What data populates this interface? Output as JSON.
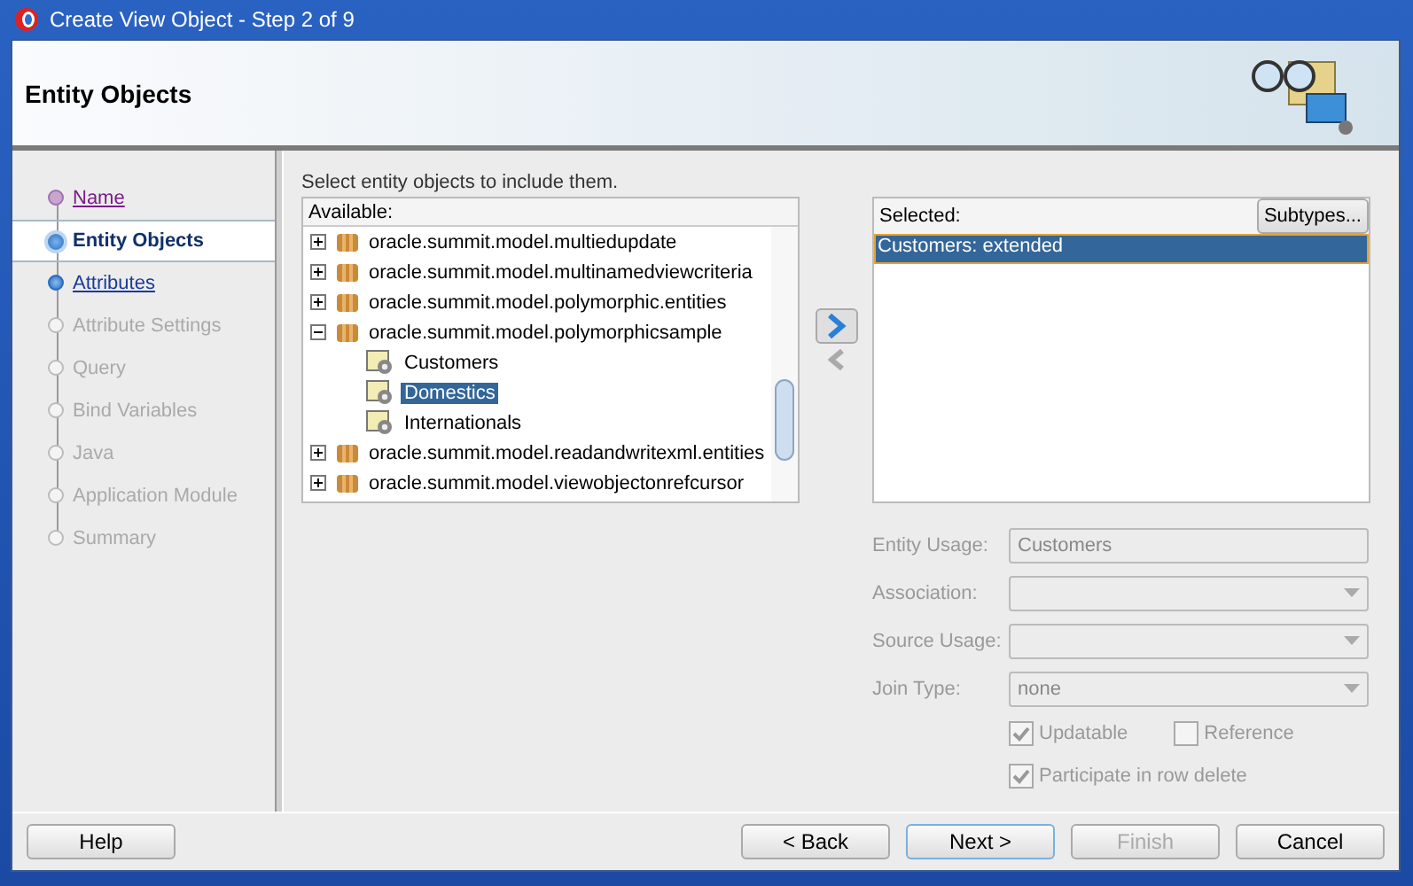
{
  "window": {
    "title": "Create View Object - Step 2 of 9"
  },
  "header": {
    "title": "Entity Objects"
  },
  "steps": [
    {
      "label": "Name",
      "kind": "visited",
      "selected": false
    },
    {
      "label": "Entity Objects",
      "kind": "current",
      "selected": true
    },
    {
      "label": "Attributes",
      "kind": "link",
      "selected": false
    },
    {
      "label": "Attribute Settings",
      "kind": "disabled",
      "selected": false
    },
    {
      "label": "Query",
      "kind": "disabled",
      "selected": false
    },
    {
      "label": "Bind Variables",
      "kind": "disabled",
      "selected": false
    },
    {
      "label": "Java",
      "kind": "disabled",
      "selected": false
    },
    {
      "label": "Application Module",
      "kind": "disabled",
      "selected": false
    },
    {
      "label": "Summary",
      "kind": "disabled",
      "selected": false
    }
  ],
  "instruction": "Select entity objects to include them.",
  "available": {
    "label": "Available:",
    "tree": [
      {
        "label": "oracle.summit.model.multiedupdate",
        "expanded": false
      },
      {
        "label": "oracle.summit.model.multinamedviewcriteria",
        "expanded": false
      },
      {
        "label": "oracle.summit.model.polymorphic.entities",
        "expanded": false
      },
      {
        "label": "oracle.summit.model.polymorphicsample",
        "expanded": true,
        "children": [
          {
            "label": "Customers",
            "selected": false
          },
          {
            "label": "Domestics",
            "selected": true
          },
          {
            "label": "Internationals",
            "selected": false
          }
        ]
      },
      {
        "label": "oracle.summit.model.readandwritexml.entities",
        "expanded": false
      },
      {
        "label": "oracle.summit.model.viewobjectonrefcursor",
        "expanded": false
      }
    ]
  },
  "selected_list": {
    "label": "Selected:",
    "subtypes_button": "Subtypes...",
    "items": [
      {
        "label": "Customers: extended",
        "selected": true
      }
    ]
  },
  "form": {
    "fields": [
      {
        "label": "Entity Usage:",
        "kind": "text",
        "value": "Customers"
      },
      {
        "label": "Association:",
        "kind": "dropdown"
      },
      {
        "label": "Source Usage:",
        "kind": "dropdown"
      },
      {
        "label": "Join Type:",
        "kind": "dropdown",
        "value": "none"
      }
    ],
    "checkboxes": [
      {
        "label": "Updatable",
        "checked": true
      },
      {
        "label": "Reference",
        "checked": false
      },
      {
        "label": "Participate in row delete",
        "checked": true
      }
    ]
  },
  "buttons": [
    {
      "label": "Help",
      "disabled": false
    },
    {
      "label": "< Back",
      "disabled": false
    },
    {
      "label": "Next >",
      "disabled": false
    },
    {
      "label": "Finish",
      "disabled": true
    },
    {
      "label": "Cancel",
      "disabled": false
    }
  ]
}
